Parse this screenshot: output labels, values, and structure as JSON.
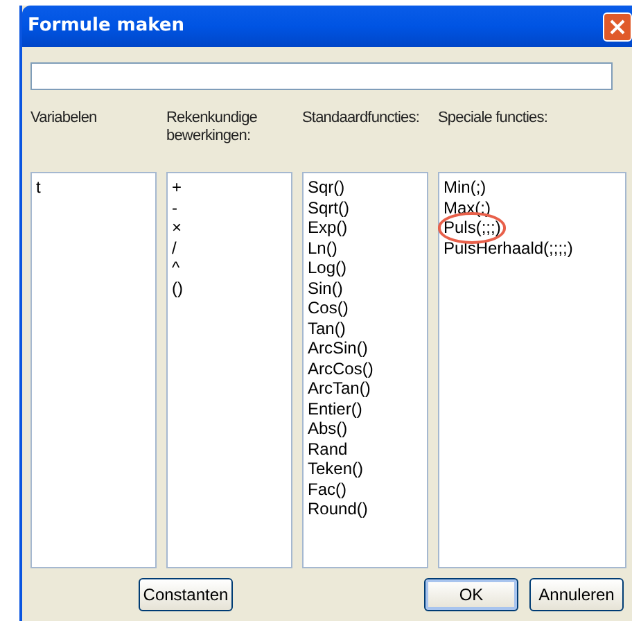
{
  "window": {
    "title": "Formule maken"
  },
  "columns": [
    {
      "heading": "Variabelen",
      "items": [
        {
          "label": "t",
          "highlighted": false
        }
      ]
    },
    {
      "heading": "Rekenkundige bewerkingen:",
      "items": [
        {
          "label": "+",
          "highlighted": false
        },
        {
          "label": "-",
          "highlighted": false
        },
        {
          "label": "×",
          "highlighted": false
        },
        {
          "label": "/",
          "highlighted": false
        },
        {
          "label": "^",
          "highlighted": false
        },
        {
          "label": "()",
          "highlighted": false
        }
      ]
    },
    {
      "heading": "Standaardfuncties:",
      "items": [
        {
          "label": "Sqr()",
          "highlighted": false
        },
        {
          "label": "Sqrt()",
          "highlighted": false
        },
        {
          "label": "Exp()",
          "highlighted": false
        },
        {
          "label": "Ln()",
          "highlighted": false
        },
        {
          "label": "Log()",
          "highlighted": false
        },
        {
          "label": "Sin()",
          "highlighted": false
        },
        {
          "label": "Cos()",
          "highlighted": false
        },
        {
          "label": "Tan()",
          "highlighted": false
        },
        {
          "label": "ArcSin()",
          "highlighted": false
        },
        {
          "label": "ArcCos()",
          "highlighted": false
        },
        {
          "label": "ArcTan()",
          "highlighted": false
        },
        {
          "label": "Entier()",
          "highlighted": false
        },
        {
          "label": "Abs()",
          "highlighted": false
        },
        {
          "label": "Rand",
          "highlighted": false
        },
        {
          "label": "Teken()",
          "highlighted": false
        },
        {
          "label": "Fac()",
          "highlighted": false
        },
        {
          "label": "Round()",
          "highlighted": false
        }
      ]
    },
    {
      "heading": "Speciale functies:",
      "items": [
        {
          "label": "Min(;)",
          "highlighted": false
        },
        {
          "label": "Max(;)",
          "highlighted": false
        },
        {
          "label": "Puls(;;;)",
          "highlighted": true
        },
        {
          "label": "PulsHerhaald(;;;;)",
          "highlighted": false
        }
      ]
    }
  ],
  "buttons": [
    {
      "label": "Constanten",
      "kind": "left"
    },
    {
      "label": "OK",
      "kind": "default"
    },
    {
      "label": "Annuleren",
      "kind": "normal"
    }
  ]
}
